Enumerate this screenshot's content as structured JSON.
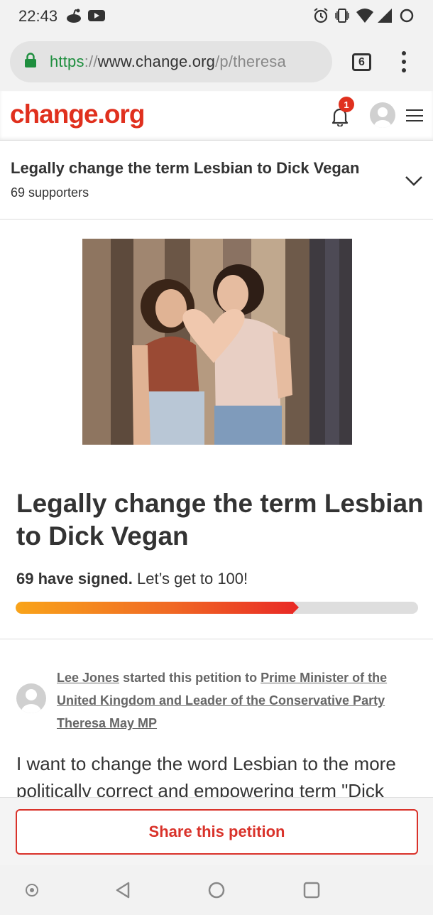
{
  "status_bar": {
    "time": "22:43"
  },
  "browser": {
    "url_scheme": "https",
    "url_sep": "://",
    "url_host": "www.change.org",
    "url_path": "/p/theresa",
    "tab_count": "6"
  },
  "header": {
    "logo": "change.org",
    "notification_count": "1"
  },
  "sticky": {
    "title": "Legally change the term Lesbian to Dick Vegan",
    "supporters": "69 supporters"
  },
  "petition": {
    "title": "Legally change the term Lesbian to Dick Vegan",
    "signed_bold": "69 have signed.",
    "signed_goal": "Let’s get to 100!",
    "progress_fraction": 0.69,
    "starter_name": "Lee Jones",
    "starter_mid": "started this petition to",
    "target": "Prime Minister of the United Kingdom and Leader of the Conservative Party Theresa May MP",
    "body": "I want to change the word Lesbian to the more politically correct and empowering term \"Dick Vegan\""
  },
  "share": {
    "label": "Share this petition"
  },
  "colors": {
    "brand_red": "#e0301e",
    "lock_green": "#1e8e3e"
  }
}
